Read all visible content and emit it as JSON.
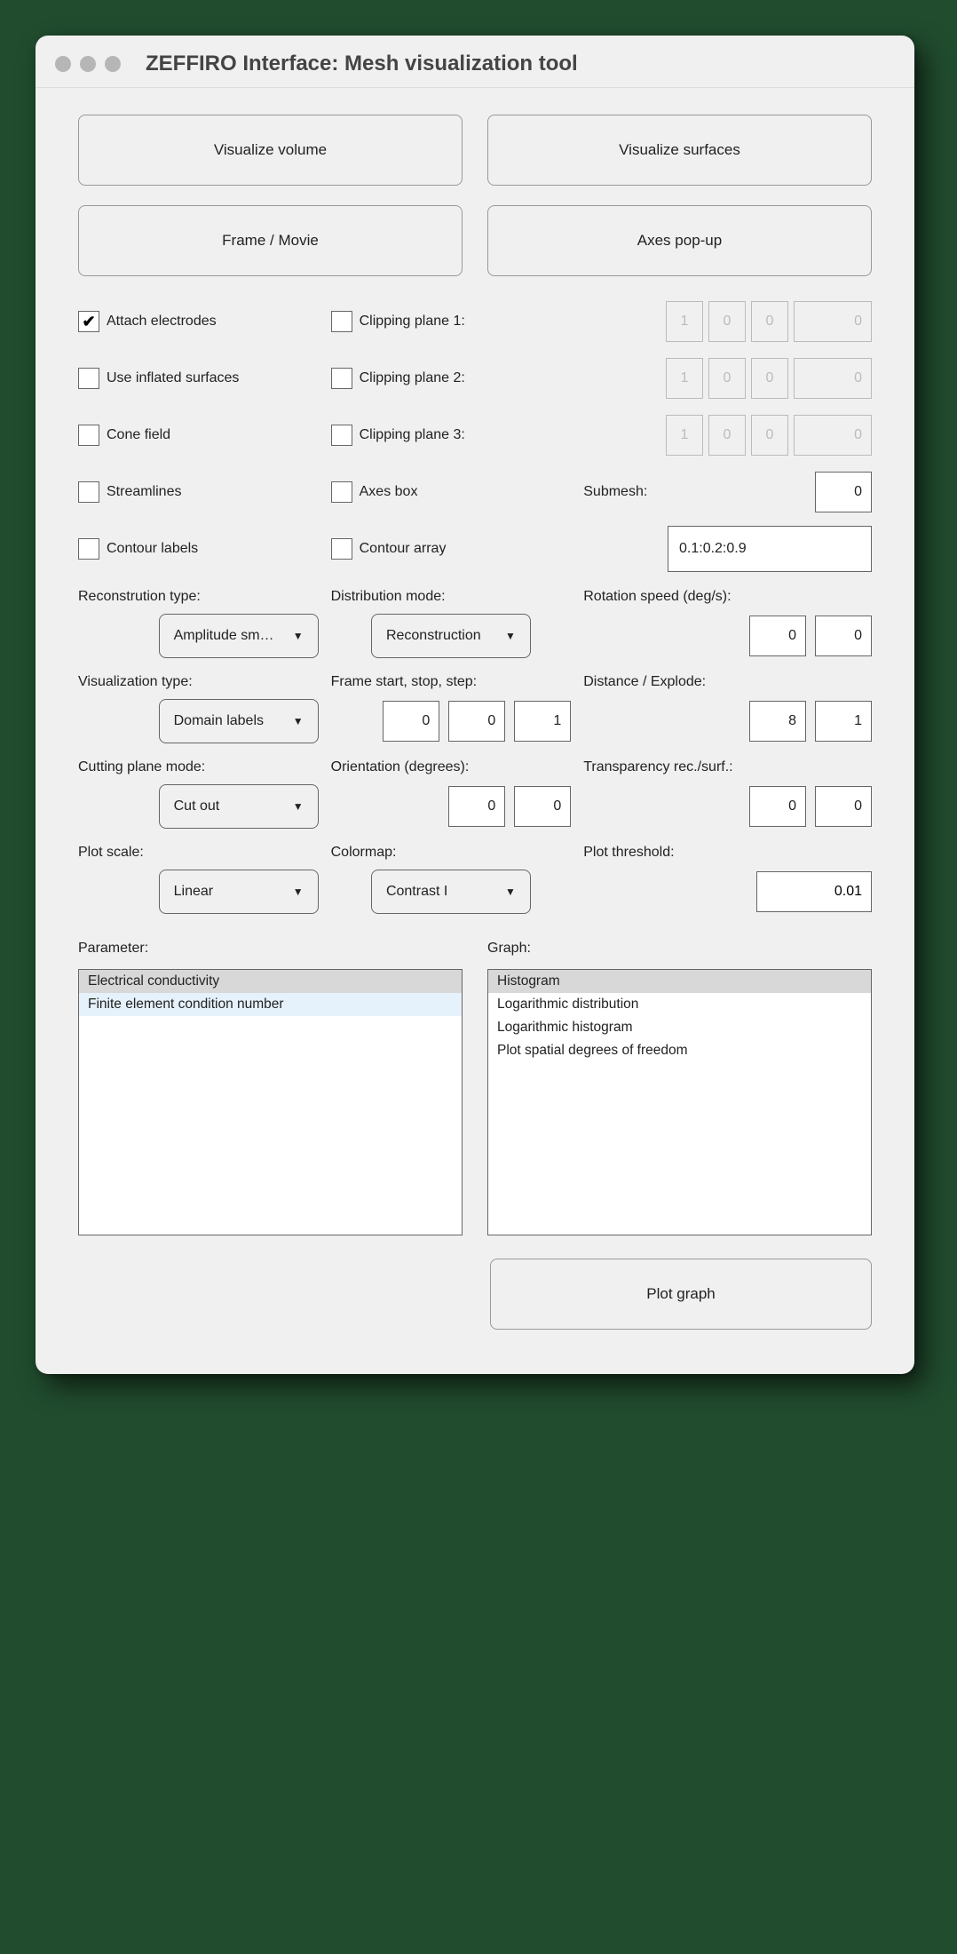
{
  "window": {
    "title": "ZEFFIRO Interface: Mesh visualization tool"
  },
  "buttons": {
    "visualize_volume": "Visualize volume",
    "visualize_surfaces": "Visualize surfaces",
    "frame_movie": "Frame / Movie",
    "axes_popup": "Axes pop-up",
    "plot_graph": "Plot graph"
  },
  "checks": {
    "attach_electrodes": {
      "label": "Attach electrodes",
      "checked": true
    },
    "use_inflated": {
      "label": "Use inflated surfaces",
      "checked": false
    },
    "cone_field": {
      "label": "Cone field",
      "checked": false
    },
    "streamlines": {
      "label": "Streamlines",
      "checked": false
    },
    "contour_labels": {
      "label": "Contour labels",
      "checked": false
    },
    "clip1": {
      "label": "Clipping plane 1:",
      "checked": false
    },
    "clip2": {
      "label": "Clipping plane 2:",
      "checked": false
    },
    "clip3": {
      "label": "Clipping plane 3:",
      "checked": false
    },
    "axes_box": {
      "label": "Axes box",
      "checked": false
    },
    "contour_array": {
      "label": "Contour array",
      "checked": false
    }
  },
  "clip_vals": {
    "p1": [
      "1",
      "0",
      "0",
      "0"
    ],
    "p2": [
      "1",
      "0",
      "0",
      "0"
    ],
    "p3": [
      "1",
      "0",
      "0",
      "0"
    ]
  },
  "submesh": {
    "label": "Submesh:",
    "value": "0"
  },
  "contour_array_value": "0.1:0.2:0.9",
  "labels": {
    "reconstruction_type": "Reconstrution type:",
    "distribution_mode": "Distribution mode:",
    "rotation_speed": "Rotation speed (deg/s):",
    "visualization_type": "Visualization type:",
    "frame_sss": "Frame start, stop, step:",
    "distance_explode": "Distance / Explode:",
    "cutting_plane_mode": "Cutting plane mode:",
    "orientation": "Orientation (degrees):",
    "transparency": "Transparency rec./surf.:",
    "plot_scale": "Plot scale:",
    "colormap": "Colormap:",
    "plot_threshold": "Plot threshold:",
    "parameter": "Parameter:",
    "graph": "Graph:"
  },
  "dropdowns": {
    "reconstruction_type": "Amplitude sm…",
    "distribution_mode": "Reconstruction",
    "visualization_type": "Domain labels",
    "cutting_plane_mode": "Cut out",
    "plot_scale": "Linear",
    "colormap": "Contrast I"
  },
  "numbers": {
    "rotation_speed": [
      "0",
      "0"
    ],
    "frame_sss": [
      "0",
      "0",
      "1"
    ],
    "distance_explode": [
      "8",
      "1"
    ],
    "orientation": [
      "0",
      "0"
    ],
    "transparency": [
      "0",
      "0"
    ],
    "plot_threshold": "0.01"
  },
  "parameter_list": [
    {
      "text": "Electrical conductivity",
      "selected": true
    },
    {
      "text": "Finite element condition number",
      "highlighted": true
    }
  ],
  "graph_list": [
    {
      "text": "Histogram",
      "selected": true
    },
    {
      "text": "Logarithmic distribution"
    },
    {
      "text": "Logarithmic histogram"
    },
    {
      "text": "Plot spatial degrees of freedom"
    }
  ]
}
